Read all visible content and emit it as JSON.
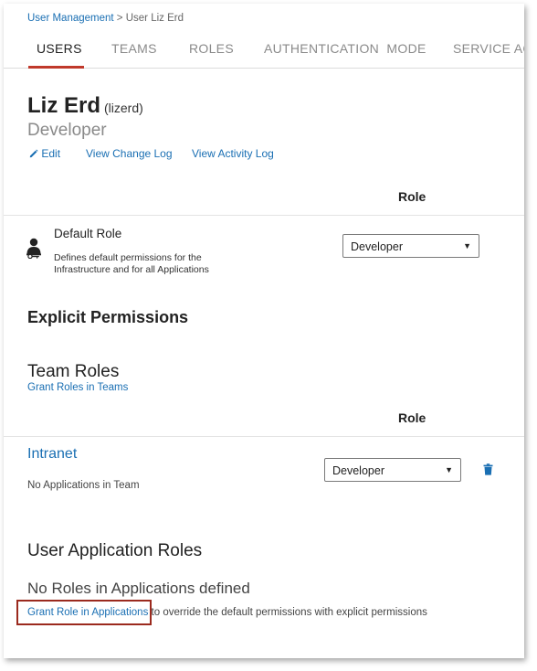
{
  "breadcrumb": {
    "root": "User Management",
    "separator": " > ",
    "current": "User Liz Erd"
  },
  "tabs": [
    {
      "label": "USERS",
      "active": true
    },
    {
      "label": "TEAMS",
      "active": false
    },
    {
      "label": "ROLES",
      "active": false
    },
    {
      "label": "AUTHENTICATION  MODE",
      "active": false
    },
    {
      "label": "SERVICE ACC",
      "active": false
    }
  ],
  "user": {
    "name": "Liz Erd",
    "login": "(lizerd)",
    "role": "Developer"
  },
  "actions": {
    "edit": "Edit",
    "change_log": "View Change Log",
    "activity_log": "View Activity Log"
  },
  "default_role": {
    "column_header": "Role",
    "title": "Default Role",
    "description_line1": "Defines default permissions for the",
    "description_line2": "Infrastructure and for all Applications",
    "selected": "Developer"
  },
  "explicit_permissions": {
    "title": "Explicit Permissions"
  },
  "team_roles": {
    "title": "Team Roles",
    "grant_link": "Grant Roles in Teams",
    "column_header": "Role",
    "teams": [
      {
        "name": "Intranet",
        "apps_note": "No Applications in Team",
        "selected": "Developer"
      }
    ]
  },
  "app_roles": {
    "title": "User Application Roles",
    "empty_title": "No Roles in Applications defined",
    "grant_link": "Grant Role in Applications",
    "grant_suffix": "to override the default permissions with explicit permissions"
  },
  "colors": {
    "link": "#1a6fb3",
    "active_tab_underline": "#c0392b",
    "highlight_box": "#9b2a1e"
  },
  "icons": {
    "edit": "pencil-icon",
    "default_role": "user-key-icon",
    "delete": "trash-icon",
    "dropdown": "caret-down-icon"
  }
}
